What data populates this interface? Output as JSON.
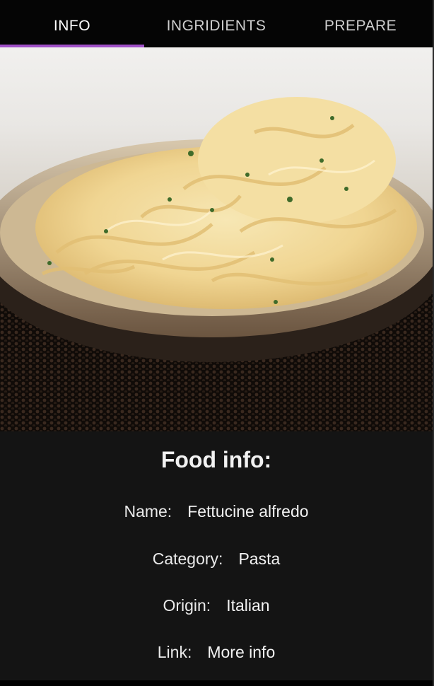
{
  "tabs": [
    {
      "label": "INFO",
      "active": true
    },
    {
      "label": "INGRIDIENTS",
      "active": false
    },
    {
      "label": "PREPARE",
      "active": false
    }
  ],
  "colors": {
    "tab_indicator": "#a050c8",
    "tabbar_bg": "#050505",
    "panel_bg": "#141414"
  },
  "hero": {
    "alt": "food-photo"
  },
  "info": {
    "title": "Food info:",
    "name_label": "Name:",
    "name_value": "Fettucine alfredo",
    "category_label": "Category:",
    "category_value": "Pasta",
    "origin_label": "Origin:",
    "origin_value": "Italian",
    "link_label": "Link:",
    "link_value": "More info"
  }
}
